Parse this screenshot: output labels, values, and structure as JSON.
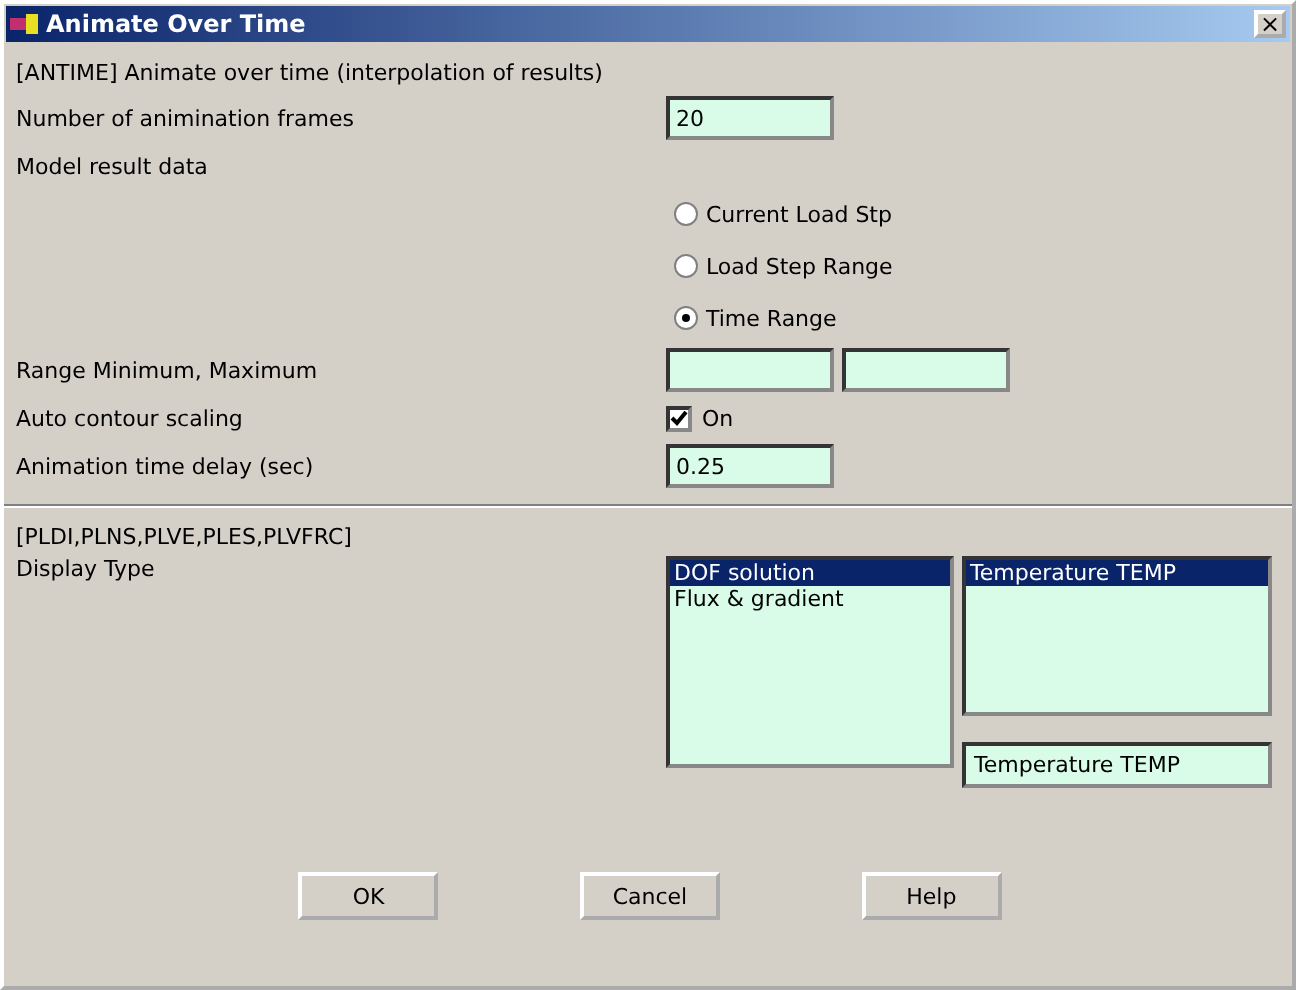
{
  "window": {
    "title": "Animate Over Time",
    "close": "×"
  },
  "command": "[ANTIME]  Animate over time (interpolation of results)",
  "frames": {
    "label": "Number of animination frames",
    "value": "20"
  },
  "model": {
    "label": "Model result data",
    "options": [
      {
        "label": "Current Load Stp",
        "selected": false
      },
      {
        "label": "Load Step Range",
        "selected": false
      },
      {
        "label": "Time Range",
        "selected": true
      }
    ]
  },
  "range": {
    "label": "Range Minimum, Maximum"
  },
  "contour": {
    "label": "Auto contour scaling",
    "option": "On",
    "checked": true
  },
  "delay": {
    "label": "Animation time delay (sec)",
    "value": "0.25"
  },
  "plot_commands": "[PLDI,PLNS,PLVE,PLES,PLVFRC]",
  "display": {
    "label": "Display Type",
    "categories": [
      {
        "label": "DOF solution",
        "selected": true
      },
      {
        "label": "Flux & gradient",
        "selected": false
      }
    ],
    "items": [
      {
        "label": "Temperature TEMP",
        "selected": true
      }
    ],
    "choice": "Temperature TEMP"
  },
  "buttons": [
    "OK",
    "Cancel",
    "Help"
  ]
}
